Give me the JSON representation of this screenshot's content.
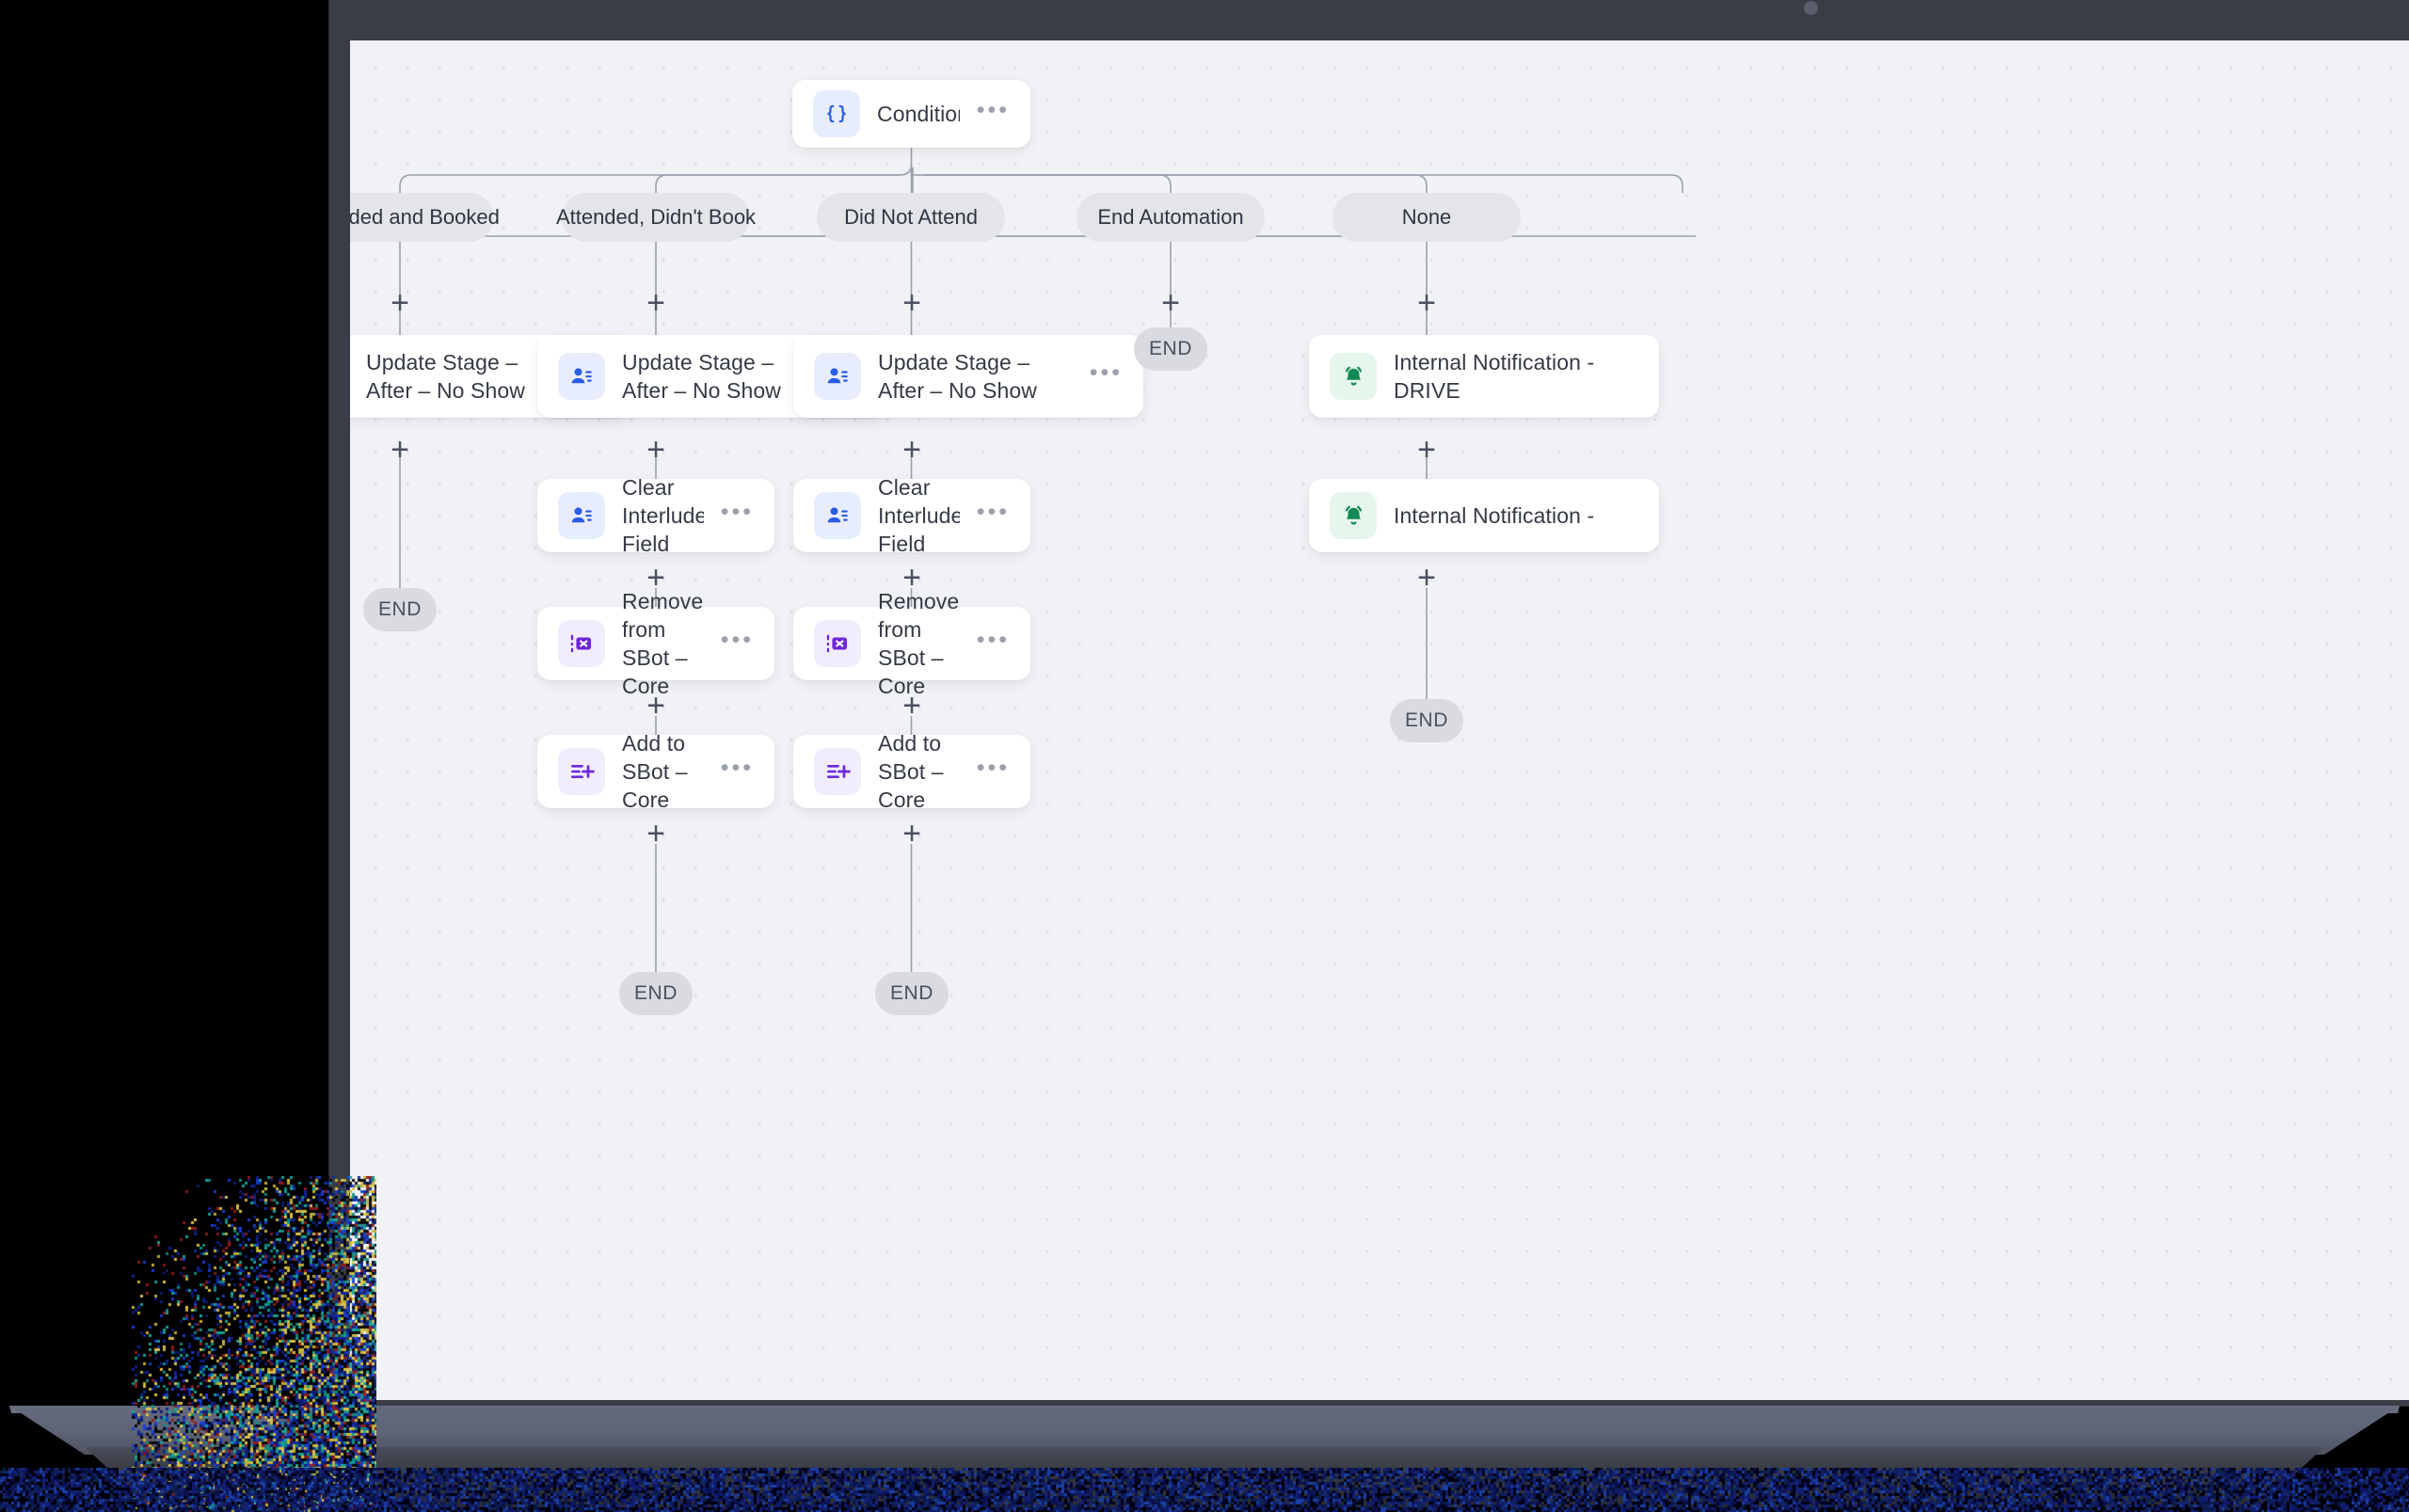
{
  "canvas": {
    "background_color": "#f1f2f5",
    "dot_color": "#dcdee4",
    "wire_color": "#9aa0ac"
  },
  "device": {
    "bezel_color": "#3a3d45",
    "base_color": "#5e6477",
    "camera_icon": "camera-dot"
  },
  "flow": {
    "root": {
      "label": "Condition",
      "icon": "braces-icon",
      "icon_glyph": "{}",
      "icon_color": "#2c5ce6",
      "menu_glyph": "•••"
    },
    "plus_glyph": "+",
    "end_label": "END",
    "branches": [
      {
        "label": "Attended and Booked"
      },
      {
        "label": "Attended, Didn't Book"
      },
      {
        "label": "Did Not Attend"
      },
      {
        "label": "End Automation"
      },
      {
        "label": "None"
      }
    ],
    "nodes": {
      "update_stage": {
        "label": "Update Stage – After – No Show",
        "icon": "contact-card-icon",
        "icon_color": "#2c5ce6",
        "icon_bg": "blue"
      },
      "clear_interlude": {
        "label": "Clear Interlude Field",
        "icon": "contact-card-icon",
        "icon_color": "#2c5ce6",
        "icon_bg": "blue"
      },
      "remove_sbot": {
        "label": "Remove from SBot – Core",
        "icon": "remove-from-list-icon",
        "icon_color": "#6d28d9",
        "icon_bg": "purple"
      },
      "add_sbot": {
        "label": "Add to SBot – Core",
        "icon": "add-to-list-icon",
        "icon_color": "#6d28d9",
        "icon_bg": "purple"
      },
      "notify_drive": {
        "label": "Internal Notification - DRIVE",
        "icon": "bell-icon",
        "icon_color": "#138a55",
        "icon_bg": "green"
      },
      "notify_plain": {
        "label": "Internal Notification -",
        "icon": "bell-icon",
        "icon_color": "#138a55",
        "icon_bg": "green"
      }
    }
  }
}
